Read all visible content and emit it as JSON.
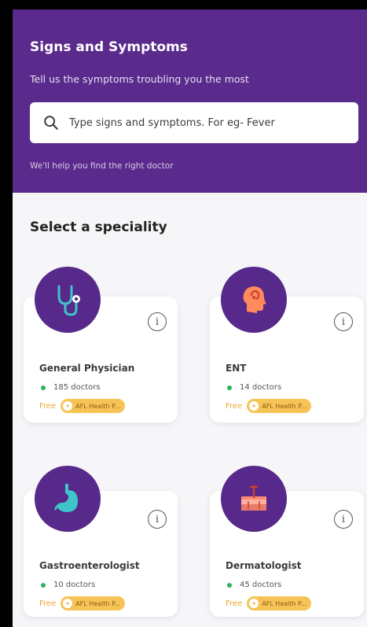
{
  "header": {
    "title": "Signs and Symptoms",
    "subtitle": "Tell us the symptoms troubling you the most",
    "help_text": "We'll help you find the right doctor"
  },
  "search": {
    "placeholder": "Type signs and symptoms. For eg- Fever",
    "icon": "search-icon"
  },
  "section": {
    "title": "Select a speciality"
  },
  "specialities": [
    {
      "name": "General Physician",
      "count": "185 doctors",
      "free_label": "Free",
      "badge": "AFL Health P...",
      "icon": "stethoscope-icon"
    },
    {
      "name": "ENT",
      "count": "14 doctors",
      "free_label": "Free",
      "badge": "AFL Health P...",
      "icon": "ear-nose-head-icon"
    },
    {
      "name": "Gastroenterologist",
      "count": "10 doctors",
      "free_label": "Free",
      "badge": "AFL Health P...",
      "icon": "stomach-icon"
    },
    {
      "name": "Dermatologist",
      "count": "45 doctors",
      "free_label": "Free",
      "badge": "AFL Health P...",
      "icon": "skin-layer-icon"
    }
  ],
  "colors": {
    "header_bg": "#5a2a8c",
    "avatar_bg": "#57298a",
    "accent_green": "#28b45a",
    "badge_bg": "#f6c456",
    "free_text": "#f0a830"
  }
}
